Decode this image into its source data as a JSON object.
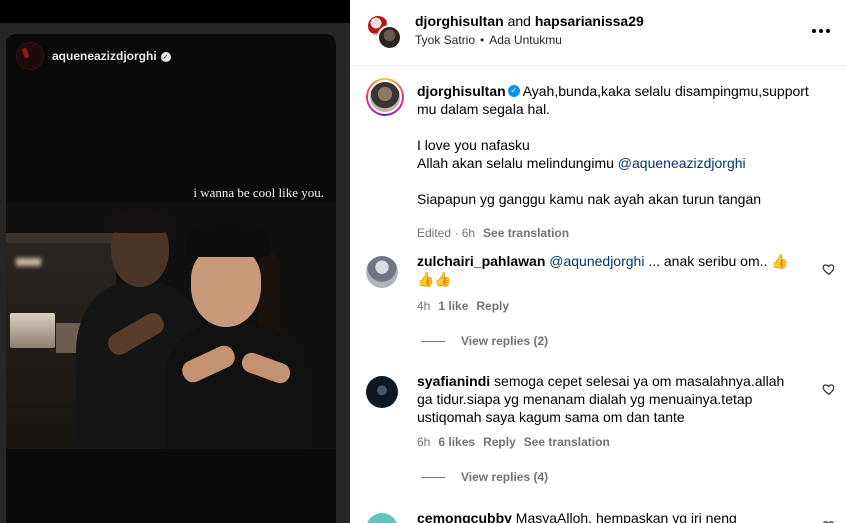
{
  "story": {
    "username": "aqueneazizdjorghi",
    "caption": "i wanna be cool like you."
  },
  "header": {
    "user1": "djorghisultan",
    "joiner": "and",
    "user2": "hapsarianissa29",
    "audio_artist": "Tyok Satrio",
    "audio_separator": "•",
    "audio_title": "Ada Untukmu"
  },
  "caption": {
    "username": "djorghisultan",
    "line1": "Ayah,bunda,kaka selalu disampingmu,support mu dalam segala hal.",
    "line2": "I love you nafasku",
    "line3": "Allah akan selalu melindungimu",
    "line3_mention": "@aqueneazizdjorghi",
    "line4": "Siapapun yg ganggu kamu nak ayah akan turun tangan",
    "meta": "Edited · 6h",
    "see_translation": "See translation"
  },
  "comments": [
    {
      "username": "zulchairi_pahlawan",
      "mention": "@aqunedjorghi",
      "text": " ... anak seribu om.. 👍👍👍",
      "time": "4h",
      "likes": "1 like",
      "reply": "Reply",
      "view_replies": "View replies (2)"
    },
    {
      "username": "syafianindi",
      "text": " semoga cepet selesai ya om masalahnya.allah ga tidur.siapa yg menanam dialah yg menuainya.tetap ustiqomah saya kagum sama om dan tante",
      "time": "6h",
      "likes": "6 likes",
      "reply": "Reply",
      "see_translation": "See translation",
      "view_replies": "View replies (4)"
    },
    {
      "username": "cemongcubby",
      "text": " MasyaAlloh, hempaskan yg iri neng"
    }
  ],
  "colors": {
    "link": "#00376b",
    "secondary_text": "#737373",
    "verified": "#0095f6"
  }
}
